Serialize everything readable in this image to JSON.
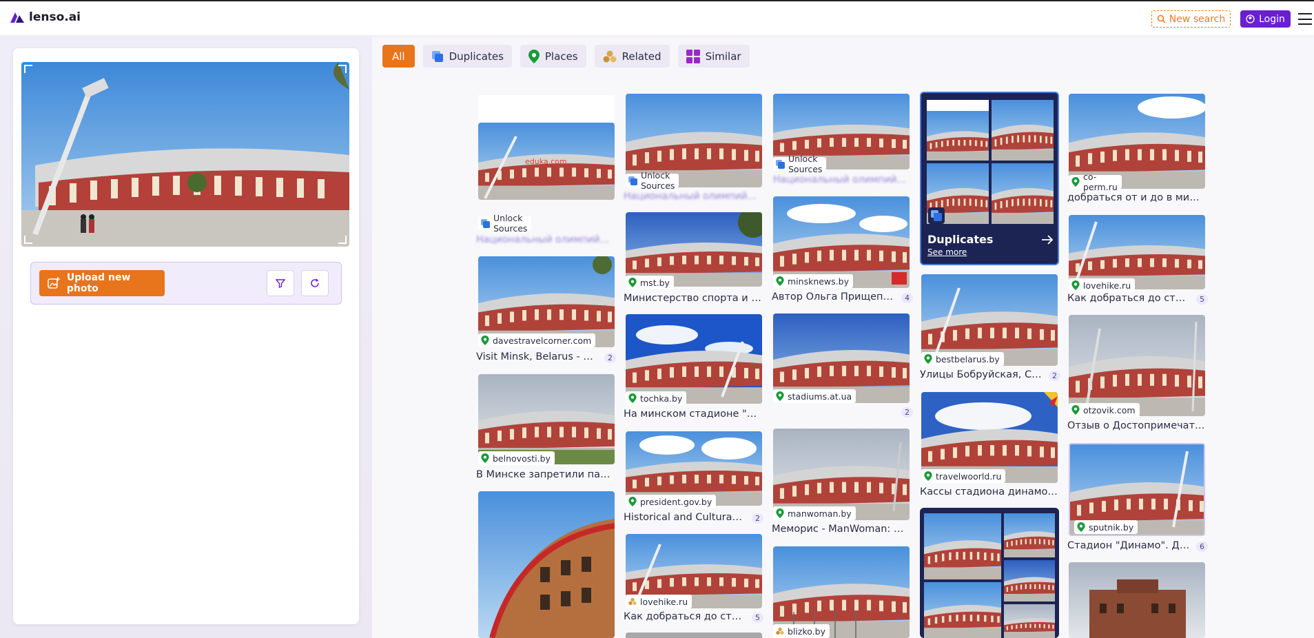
{
  "header": {
    "logo_text": "lenso.ai",
    "new_search_label": "New search",
    "login_label": "Login"
  },
  "left": {
    "upload_label": "Upload new photo"
  },
  "filters": [
    {
      "label": "All",
      "active": true
    },
    {
      "label": "Duplicates",
      "icon": "duplicates-icon"
    },
    {
      "label": "Places",
      "icon": "pin-icon"
    },
    {
      "label": "Related",
      "icon": "related-icon"
    },
    {
      "label": "Similar",
      "icon": "similar-icon"
    }
  ],
  "results": {
    "col1": [
      {
        "source": "Unlock Sources",
        "title": "Национальный олимпий...",
        "locked": true
      },
      {
        "source": "davestravelcorner.com",
        "title": "Visit Minsk, Belarus - Dec...",
        "count": "2"
      },
      {
        "source": "belnovosti.by",
        "title": "В Минске запретили парков..."
      }
    ],
    "col2": [
      {
        "source": "Unlock Sources",
        "title": "Национальный олимпий...",
        "locked": true
      },
      {
        "source": "mst.by",
        "title": "Министерство спорта и тур..."
      },
      {
        "source": "tochka.by",
        "title": "На минском стадионе \"Дин..."
      },
      {
        "source": "president.gov.by",
        "title": "Historical and Cultural He...",
        "count": "2"
      },
      {
        "source": "lovehike.ru",
        "title": "Как добраться до стадио...",
        "count": "5"
      }
    ],
    "col3": [
      {
        "source": "Unlock Sources",
        "title": "Национальный олимпий...",
        "locked": true
      },
      {
        "source": "minsknews.by",
        "title": "Автор Ольга Прищепчик...",
        "count": "4"
      },
      {
        "source": "stadiums.at.ua",
        "title": "",
        "count": "2"
      },
      {
        "source": "manwoman.by",
        "title": "Меморис - ManWoman: инт..."
      },
      {
        "source": "blizko.by",
        "title": ""
      }
    ],
    "col4": [
      {
        "source": "bestbelarus.by",
        "title": "Улицы Бобруйская, Свер...",
        "count": "2"
      },
      {
        "source": "travelwoorld.ru",
        "title": "Кассы стадиона динамо ми..."
      }
    ],
    "col5": [
      {
        "source": "co-perm.ru",
        "title": "добраться от и до в минске ..."
      },
      {
        "source": "lovehike.ru",
        "title": "Как добраться до стадио...",
        "count": "5"
      },
      {
        "source": "otzovik.com",
        "title": "Отзыв о Достопримечатель..."
      },
      {
        "source": "sputnik.by",
        "title": "Стадион \"Динамо\". День ...",
        "count": "6"
      }
    ],
    "duplicates_tile": {
      "title": "Duplicates",
      "link": "See more"
    }
  }
}
